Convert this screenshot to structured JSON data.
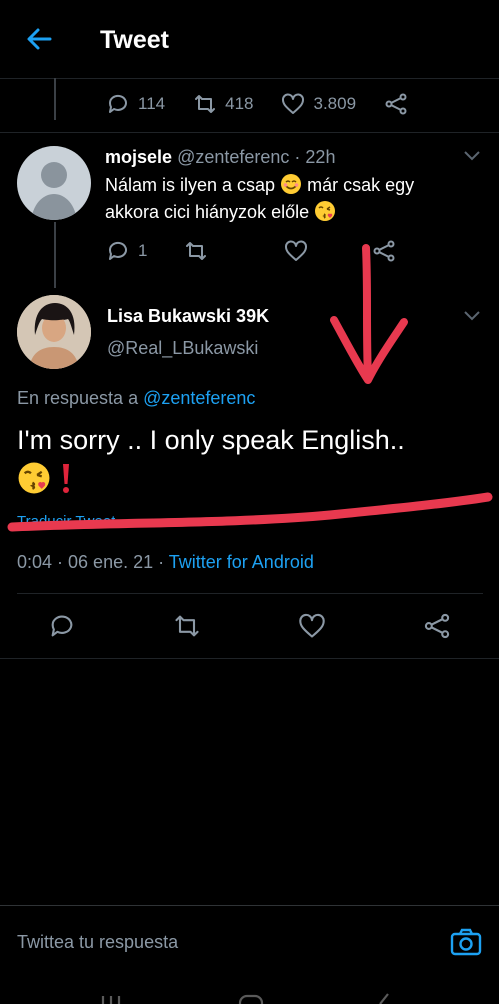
{
  "header": {
    "title": "Tweet"
  },
  "prev_tweet_stats": {
    "replies": "114",
    "retweets": "418",
    "likes": "3.809"
  },
  "reply_tweet": {
    "name": "mojsele",
    "handle": "@zenteferenc",
    "time": "· 22h",
    "text_line1_a": "Nálam is ilyen a csap ",
    "text_line1_b": " már csak egy",
    "text_line2": "akkora cici hiányzok előle ",
    "replies": "1"
  },
  "main_tweet": {
    "name": "Lisa Bukawski 39K",
    "handle": "@Real_LBukawski",
    "replying_prefix": "En respuesta a ",
    "replying_to": "@zenteferenc",
    "text": "I'm sorry .. I only speak English..",
    "translate": "Traducir Tweet",
    "time_date": "0:04 · 06 ene. 21 · ",
    "source": "Twitter for Android"
  },
  "reply_input": {
    "placeholder": "Twittea tu respuesta"
  },
  "colors": {
    "accent": "#1da1f2",
    "annotation": "#e8394f"
  },
  "icons": [
    "back-arrow-icon",
    "reply-icon",
    "retweet-icon",
    "like-icon",
    "share-icon",
    "chevron-down-icon",
    "camera-icon"
  ]
}
